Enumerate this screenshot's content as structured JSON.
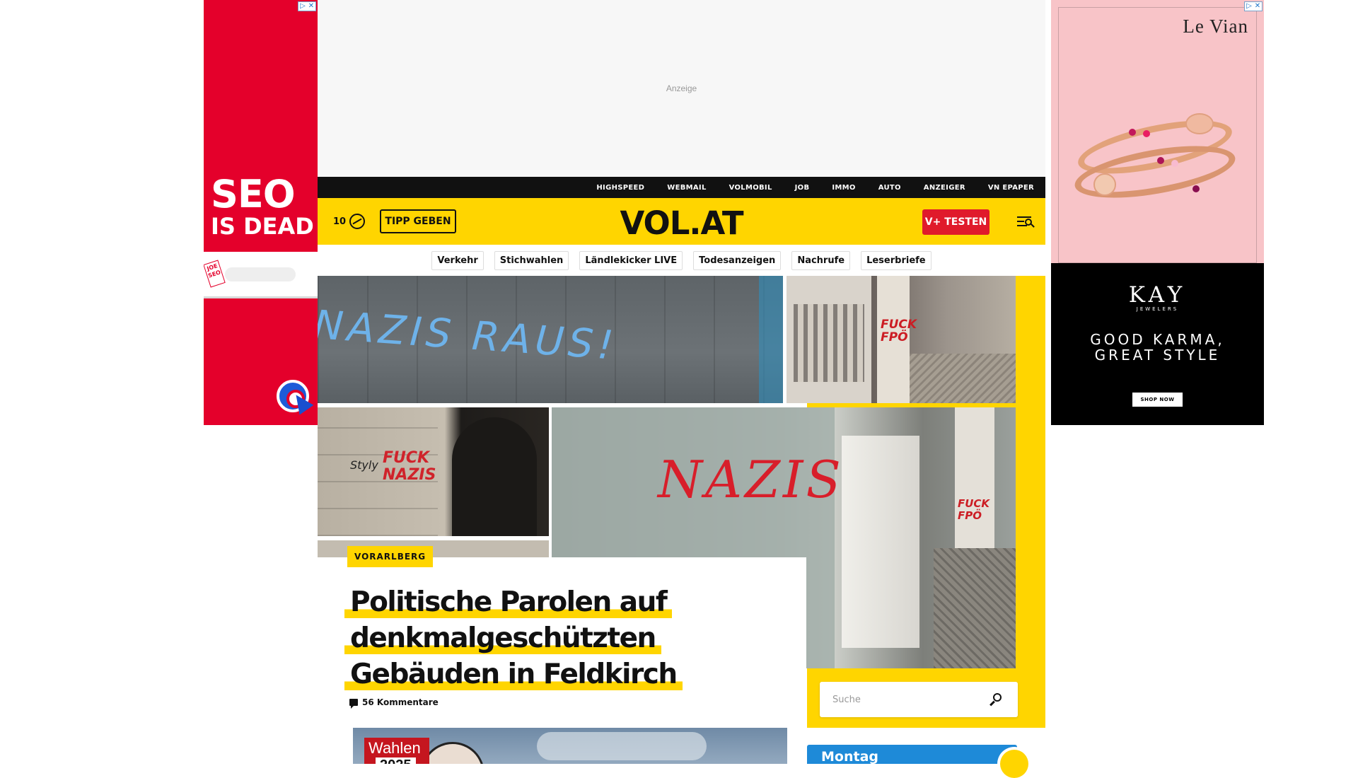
{
  "ads": {
    "left": {
      "line1": "SEO",
      "line2": "IS DEAD",
      "adchoice_play": "▷",
      "adchoice_close": "✕",
      "tag": "JOE SEO"
    },
    "top": {
      "label": "Anzeige"
    },
    "right": {
      "brand": "Le Vian",
      "adchoice_play": "▷",
      "adchoice_close": "✕",
      "kay": "KAY",
      "jewelers": "JEWELERS",
      "slogan_line1": "GOOD KARMA,",
      "slogan_line2": "GREAT STYLE",
      "cta": "SHOP NOW"
    }
  },
  "service_bar": {
    "links": [
      "HIGHSPEED",
      "WEBMAIL",
      "VOLMOBIL",
      "JOB",
      "IMMO",
      "AUTO",
      "ANZEIGER",
      "VN EPAPER"
    ]
  },
  "header": {
    "weather_temp": "10",
    "tipp_label": "TIPP GEBEN",
    "logo": "VOL.AT",
    "vplus_label": "V+ TESTEN"
  },
  "topics": [
    "Verkehr",
    "Stichwahlen",
    "Ländlekicker LIVE",
    "Todesanzeigen",
    "Nachrufe",
    "Leserbriefe"
  ],
  "article": {
    "category": "VORARLBERG",
    "headline": "Politische Parolen auf denkmalgeschützten Gebäuden in Feldkirch",
    "comments": "56 Kommentare"
  },
  "search": {
    "placeholder": "Suche"
  },
  "teaser": {
    "badge": "Wahlen",
    "year": "2025"
  },
  "day_card": {
    "label": "Montag"
  },
  "colors": {
    "brand_yellow": "#ffd500",
    "accent_red": "#e01a2b",
    "service_bar": "#111111",
    "day_card_blue": "#1e8ad8"
  }
}
